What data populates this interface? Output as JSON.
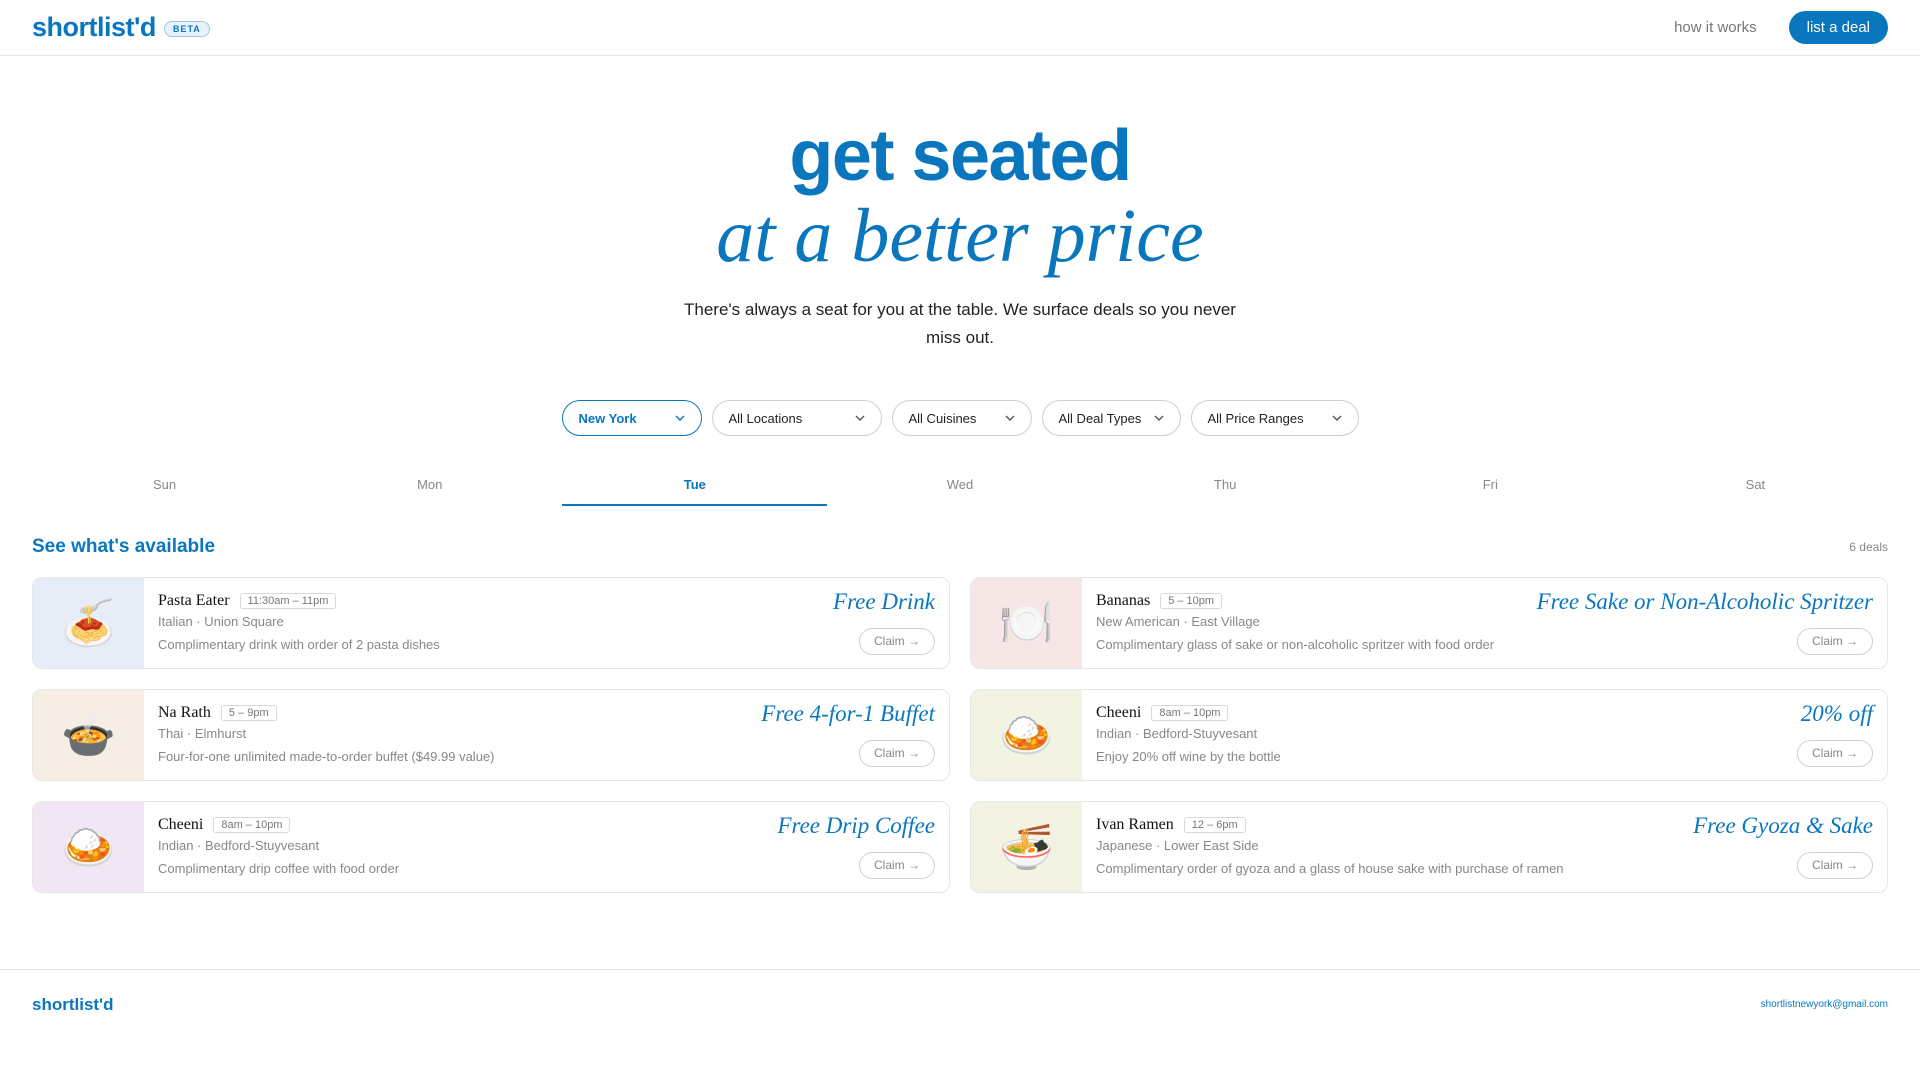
{
  "header": {
    "brand": "shortlist'd",
    "badge": "BETA",
    "nav_link": "how it works",
    "cta": "list a deal"
  },
  "hero": {
    "title": "get seated",
    "subtitle": "at a better price",
    "copy": "There's always a seat for you at the table. We surface deals so you never miss out."
  },
  "filters": [
    {
      "label": "New York",
      "selected": true
    },
    {
      "label": "All Locations",
      "selected": false
    },
    {
      "label": "All Cuisines",
      "selected": false
    },
    {
      "label": "All Deal Types",
      "selected": false
    },
    {
      "label": "All Price Ranges",
      "selected": false
    }
  ],
  "days": {
    "items": [
      "Sun",
      "Mon",
      "Tue",
      "Wed",
      "Thu",
      "Fri",
      "Sat"
    ],
    "active": "Tue"
  },
  "section": {
    "title": "See what's available",
    "count": "6 deals"
  },
  "deals": [
    {
      "emoji": "🍝",
      "name": "Pasta Eater",
      "hours": "11:30am – 11pm",
      "meta": "Italian · Union Square",
      "desc": "Complimentary drink with order of 2 pasta dishes",
      "deal": "Free Drink",
      "claim": "Claim →",
      "bg": "#e7edf6"
    },
    {
      "emoji": "🍽️",
      "name": "Bananas",
      "hours": "5 – 10pm",
      "meta": "New American · East Village",
      "desc": "Complimentary glass of sake or non-alcoholic spritzer with food order",
      "deal": "Free Sake or Non-Alcoholic Spritzer",
      "claim": "Claim →",
      "bg": "#f6e7e6"
    },
    {
      "emoji": "🍲",
      "name": "Na Rath",
      "hours": "5 – 9pm",
      "meta": "Thai · Elmhurst",
      "desc": "Four-for-one unlimited made-to-order buffet ($49.99 value)",
      "deal": "Free 4-for-1 Buffet",
      "claim": "Claim →",
      "bg": "#f6ede5"
    },
    {
      "emoji": "🍛",
      "name": "Cheeni",
      "hours": "8am – 10pm",
      "meta": "Indian · Bedford-Stuyvesant",
      "desc": "Enjoy 20% off wine by the bottle",
      "deal": "20% off",
      "claim": "Claim →",
      "bg": "#f3f3e4"
    },
    {
      "emoji": "🍛",
      "name": "Cheeni",
      "hours": "8am – 10pm",
      "meta": "Indian · Bedford-Stuyvesant",
      "desc": "Complimentary drip coffee with food order",
      "deal": "Free Drip Coffee",
      "claim": "Claim →",
      "bg": "#f1e6f4"
    },
    {
      "emoji": "🍜",
      "name": "Ivan Ramen",
      "hours": "12 – 6pm",
      "meta": "Japanese · Lower East Side",
      "desc": "Complimentary order of gyoza and a glass of house sake with purchase of ramen",
      "deal": "Free Gyoza & Sake",
      "claim": "Claim →",
      "bg": "#f3f3e4"
    }
  ],
  "footer": {
    "brand": "shortlist'd",
    "email": "shortlistnewyork@gmail.com"
  },
  "colors": {
    "accent": "#0a76bd"
  }
}
